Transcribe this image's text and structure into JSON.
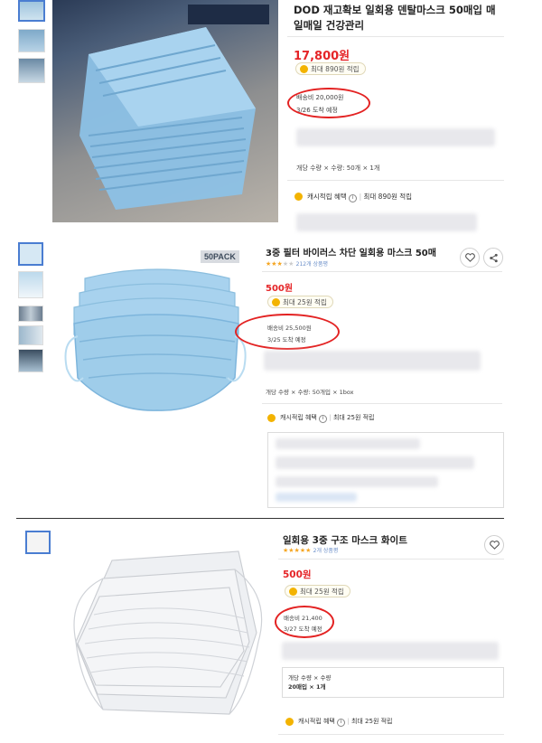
{
  "products": [
    {
      "title_line1": "DOD 재고확보 일회용 덴탈마스크 50매입 매",
      "title_line2": "일매일 건강관리",
      "price": "17,800원",
      "points_badge": "최대 890원 적립",
      "shipping": "배송비 20,000원",
      "arrival": "3/26 도착 예정",
      "option": "개당 수량 × 수량: 50개 × 1개",
      "cash_label": "캐시적립 혜택",
      "cash_info_icon": "info-icon",
      "cash_value": "최대 890원 적립"
    },
    {
      "title": "3중 필터 바이러스 차단 일회용 마스크 50매",
      "reviews": "212개 상품평",
      "pack_badge": "50PACK",
      "price": "500원",
      "points_badge": "최대 25원 적립",
      "shipping": "배송비 25,500원",
      "arrival": "3/25 도착 예정",
      "option": "개당 수량 × 수량: 50개입 × 1box",
      "cash_label": "캐시적립 혜택",
      "cash_value": "최대 25원 적립"
    },
    {
      "title": "일회용 3중 구조 마스크 화이트",
      "reviews": "2개 상품평",
      "price": "500원",
      "points_badge": "최대 25원 적립",
      "shipping": "배송비 21,400",
      "arrival": "3/27 도착 예정",
      "option_line1": "개당 수량 × 수량",
      "option_line2": "20매입 × 1개",
      "cash_label": "캐시적립 혜택",
      "cash_value": "최대 25원 적립"
    }
  ],
  "colors": {
    "price_red": "#e52528",
    "coin": "#f3b300",
    "star": "#f5a623",
    "annotation": "#e32222"
  },
  "icons": [
    "heart-icon",
    "share-icon",
    "coin-icon",
    "info-icon",
    "star-icon"
  ]
}
